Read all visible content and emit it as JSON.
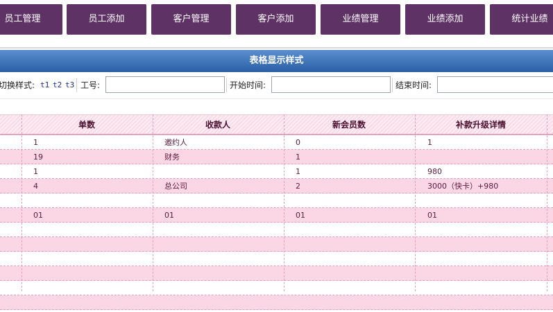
{
  "nav": {
    "items": [
      "员工管理",
      "员工添加",
      "客户管理",
      "客户添加",
      "业绩管理",
      "业绩添加",
      "统计业绩"
    ]
  },
  "title_bar": {
    "title": "表格显示样式"
  },
  "filter": {
    "style_label": "切换样式:",
    "styles": [
      "t1",
      "t2",
      "t3"
    ],
    "employee_label": "工号:",
    "employee_value": "",
    "start_label": "开始时间:",
    "start_value": "",
    "end_label": "结束时间:",
    "end_value": ""
  },
  "table": {
    "columns": [
      "单数",
      "收款人",
      "新会员数",
      "补款升级详情"
    ],
    "rows": [
      [
        "1",
        "邀约人",
        "0",
        "1"
      ],
      [
        "19",
        "财务",
        "1",
        ""
      ],
      [
        "1",
        "",
        "1",
        "980"
      ],
      [
        "4",
        "总公司",
        "2",
        "3000（快卡）+980"
      ],
      [
        "",
        "",
        "",
        ""
      ],
      [
        "01",
        "01",
        "01",
        "01"
      ],
      [
        "",
        "",
        "",
        ""
      ],
      [
        "",
        "",
        "",
        ""
      ],
      [
        "",
        "",
        "",
        ""
      ],
      [
        "",
        "",
        "",
        ""
      ],
      [
        "",
        "",
        "",
        ""
      ],
      [
        "",
        "",
        "",
        ""
      ]
    ]
  },
  "colors": {
    "nav_bg": "#5e3265",
    "header_bar": "#2a5fa5",
    "row_alt": "#fbd7e5",
    "cell_text": "#5a1a3a"
  }
}
